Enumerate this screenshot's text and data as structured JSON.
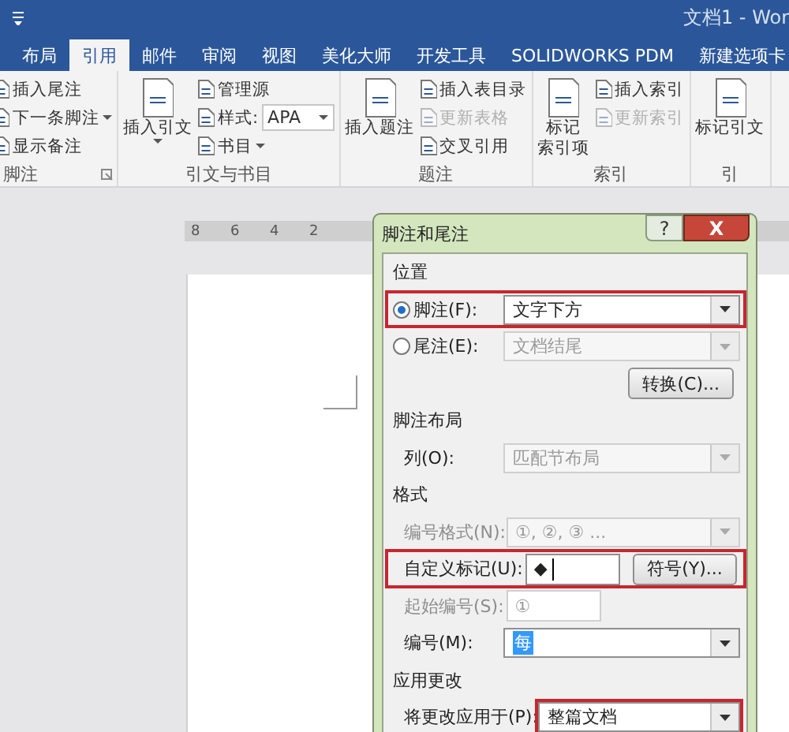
{
  "window": {
    "title": "文档1 - Wor"
  },
  "tabs": [
    {
      "label": "布局",
      "selected": false
    },
    {
      "label": "引用",
      "selected": true
    },
    {
      "label": "邮件",
      "selected": false
    },
    {
      "label": "审阅",
      "selected": false
    },
    {
      "label": "视图",
      "selected": false
    },
    {
      "label": "美化大师",
      "selected": false
    },
    {
      "label": "开发工具",
      "selected": false
    },
    {
      "label": "SOLIDWORKS PDM",
      "selected": false
    },
    {
      "label": "新建选项卡",
      "selected": false
    }
  ],
  "ribbon": {
    "groups": [
      {
        "label": "脚注",
        "launcher": true,
        "small": [
          {
            "kind": "button",
            "label": "插入尾注",
            "disabled": false,
            "dropdown": false
          },
          {
            "kind": "button",
            "label": "下一条脚注",
            "disabled": false,
            "dropdown": true
          },
          {
            "kind": "button",
            "label": "显示备注",
            "disabled": false,
            "dropdown": false
          }
        ]
      },
      {
        "label": "引文与书目",
        "launcher": false,
        "large": [
          {
            "lines": [
              "插入引文"
            ],
            "dropdown": true
          }
        ],
        "small": [
          {
            "kind": "button",
            "label": "管理源",
            "disabled": false,
            "dropdown": false
          },
          {
            "kind": "combo",
            "label": "样式:",
            "value": "APA",
            "dropdown": true
          },
          {
            "kind": "button",
            "label": "书目",
            "disabled": false,
            "dropdown": true
          }
        ]
      },
      {
        "label": "题注",
        "launcher": false,
        "large": [
          {
            "lines": [
              "插入题注"
            ],
            "dropdown": false
          }
        ],
        "small": [
          {
            "kind": "button",
            "label": "插入表目录",
            "disabled": false,
            "dropdown": false
          },
          {
            "kind": "button",
            "label": "更新表格",
            "disabled": true,
            "dropdown": false
          },
          {
            "kind": "button",
            "label": "交叉引用",
            "disabled": false,
            "dropdown": false
          }
        ]
      },
      {
        "label": "索引",
        "launcher": false,
        "large": [
          {
            "lines": [
              "标记",
              "索引项"
            ],
            "dropdown": false
          }
        ],
        "small": [
          {
            "kind": "button",
            "label": "插入索引",
            "disabled": false,
            "dropdown": false
          },
          {
            "kind": "button",
            "label": "更新索引",
            "disabled": true,
            "dropdown": false
          }
        ]
      },
      {
        "label": "引",
        "launcher": false,
        "large": [
          {
            "lines": [
              "标记引文"
            ],
            "dropdown": false
          }
        ]
      }
    ]
  },
  "ruler": {
    "numbers": [
      "8",
      "6",
      "4",
      "2"
    ]
  },
  "dialog": {
    "title": "脚注和尾注",
    "help_button": "?",
    "close_button": "X",
    "sections": [
      {
        "heading": "位置",
        "rows": [
          {
            "kind": "radio",
            "label": "脚注(F):",
            "selected": true,
            "value": "文字下方",
            "disabled": false,
            "label_disabled": false,
            "row_highlighted": true,
            "field_highlighted": false
          },
          {
            "kind": "radio",
            "label": "尾注(E):",
            "selected": false,
            "value": "文档结尾",
            "disabled": true,
            "label_disabled": false,
            "row_highlighted": false,
            "field_highlighted": false
          },
          {
            "kind": "button",
            "label": "转换(C)...",
            "row_highlighted": false
          }
        ]
      },
      {
        "heading": "脚注布局",
        "rows": [
          {
            "kind": "select",
            "label": "列(O):",
            "value": "匹配节布局",
            "disabled": true,
            "label_disabled": false,
            "row_highlighted": false,
            "field_highlighted": false
          }
        ]
      },
      {
        "heading": "格式",
        "rows": [
          {
            "kind": "select",
            "label": "编号格式(N):",
            "value": "①, ②, ③ ...",
            "disabled": true,
            "label_disabled": true,
            "row_highlighted": false,
            "field_highlighted": false
          },
          {
            "kind": "input",
            "label": "自定义标记(U):",
            "value": "◆",
            "button": "符号(Y)...",
            "disabled": false,
            "label_disabled": false,
            "row_highlighted": true,
            "field_highlighted": false
          },
          {
            "kind": "number",
            "label": "起始编号(S):",
            "value": "①",
            "disabled": true,
            "label_disabled": true,
            "row_highlighted": false,
            "field_highlighted": false
          },
          {
            "kind": "select",
            "label": "编号(M):",
            "value": "每",
            "value_selected": true,
            "disabled": false,
            "label_disabled": false,
            "row_highlighted": false,
            "field_highlighted": false
          }
        ]
      },
      {
        "heading": "应用更改",
        "rows": [
          {
            "kind": "select",
            "label": "将更改应用于(P):",
            "value": "整篇文档",
            "disabled": false,
            "label_disabled": false,
            "row_highlighted": false,
            "field_highlighted": true
          }
        ]
      }
    ]
  }
}
